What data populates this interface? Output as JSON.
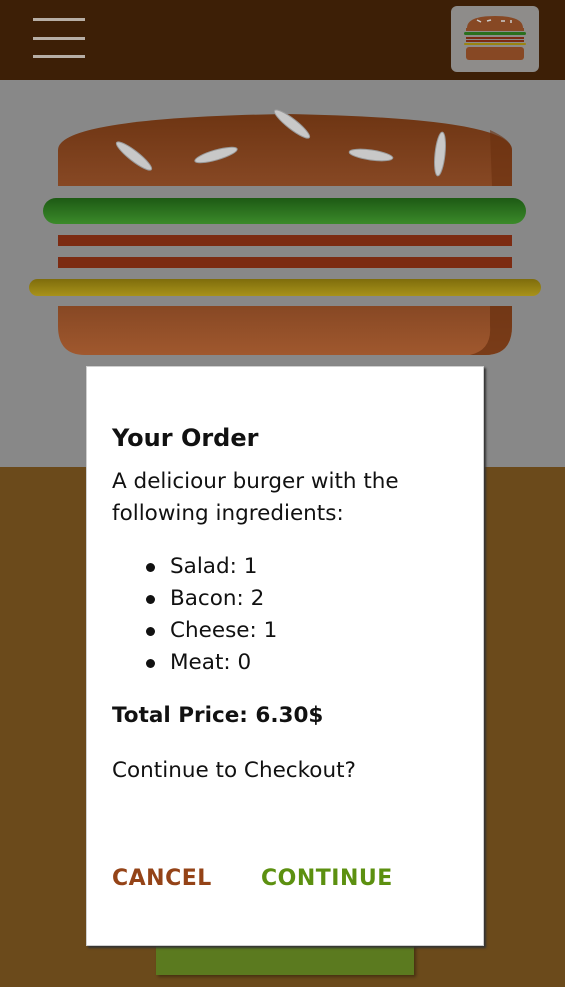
{
  "colors": {
    "toolbar": "#3d1f06",
    "burger_background": "#888888",
    "page_background": "#6b4a1b",
    "bun": "#874824",
    "salad": "#2a6f1d",
    "bacon": "#7c2b12",
    "cheese": "#9a8410",
    "cancel": "#944317",
    "continue": "#5c9010"
  },
  "icons": {
    "menu": "hamburger-menu-icon",
    "logo": "burger-logo-icon"
  },
  "modal": {
    "title": "Your Order",
    "intro": "A deliciour burger with the following ingredients:",
    "ingredients": [
      "Salad: 1",
      "Bacon: 2",
      "Cheese: 1",
      "Meat: 0"
    ],
    "total": "Total Price: 6.30$",
    "question": "Continue to Checkout?",
    "cancel_label": "CANCEL",
    "continue_label": "CONTINUE"
  }
}
